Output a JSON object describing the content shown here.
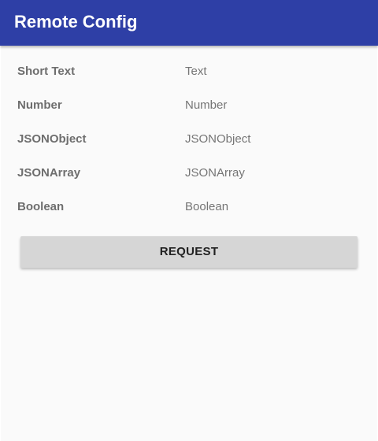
{
  "app_bar": {
    "title": "Remote Config",
    "color": "#2e3fa6"
  },
  "config_rows": [
    {
      "label": "Short Text",
      "value": "Text"
    },
    {
      "label": "Number",
      "value": "Number"
    },
    {
      "label": "JSONObject",
      "value": "JSONObject"
    },
    {
      "label": "JSONArray",
      "value": "JSONArray"
    },
    {
      "label": "Boolean",
      "value": "Boolean"
    }
  ],
  "request_button": {
    "label": "REQUEST"
  }
}
